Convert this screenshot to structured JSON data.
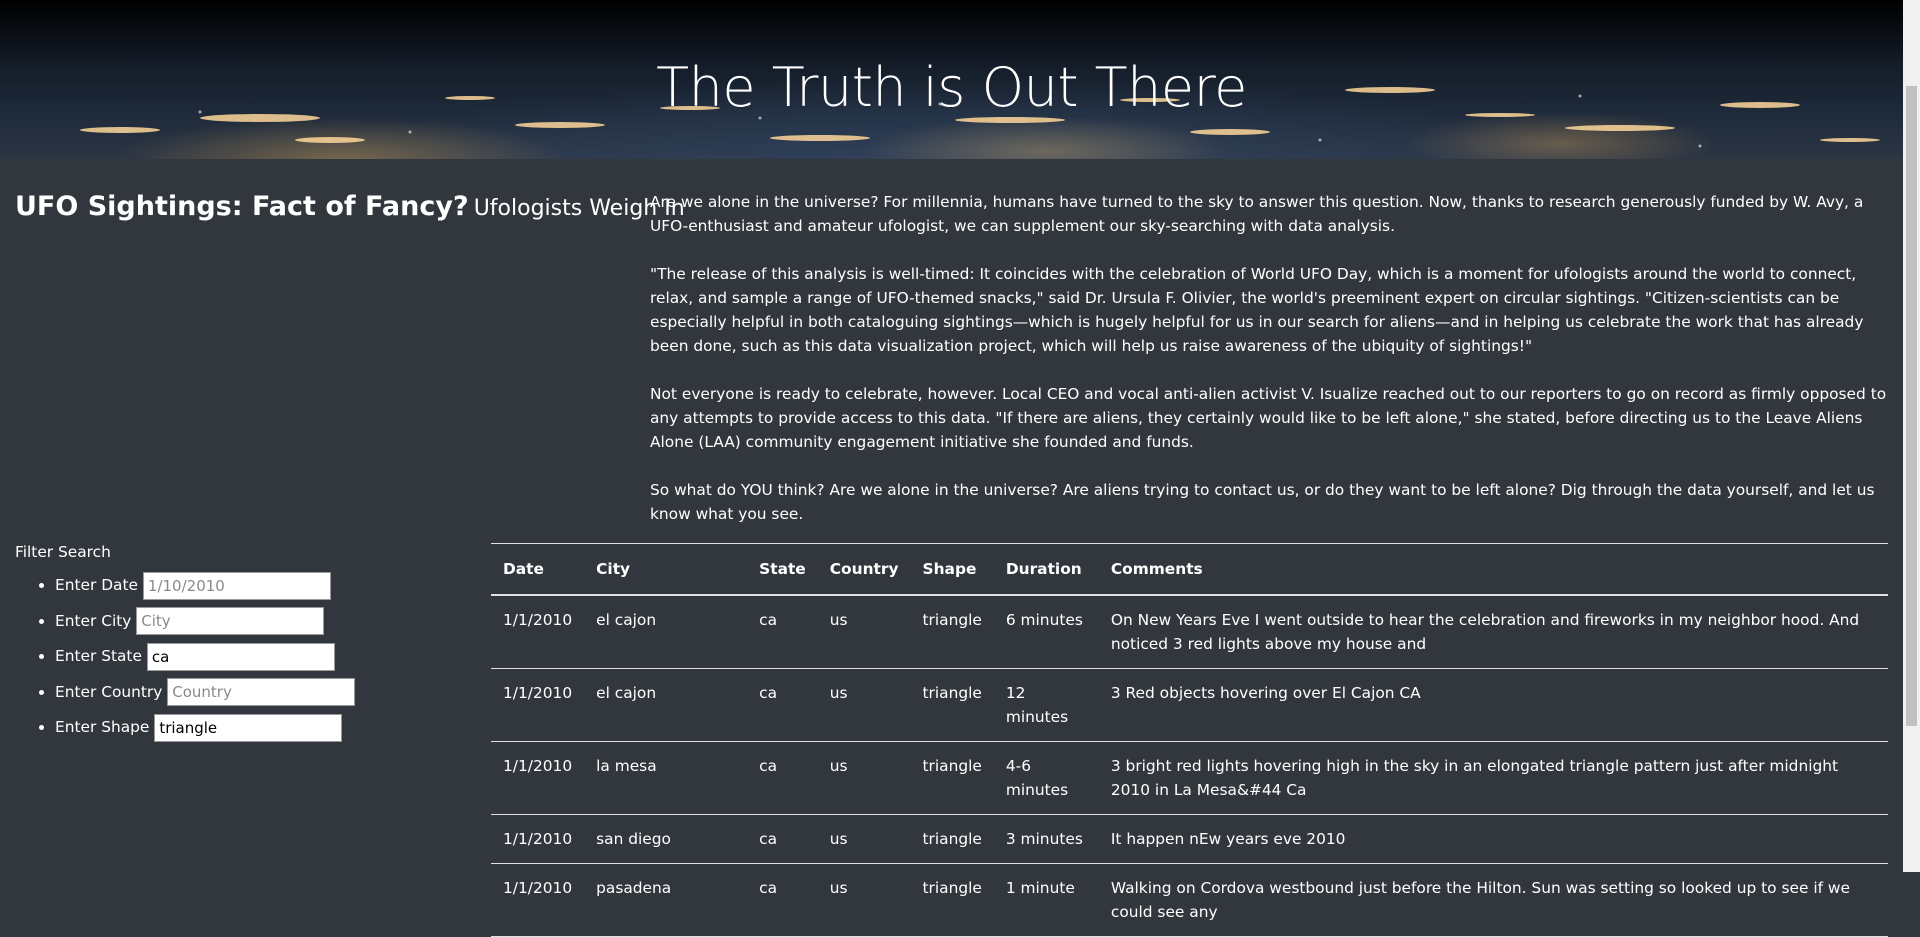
{
  "header": {
    "title": "The Truth is Out There"
  },
  "headline": {
    "main": "UFO Sightings: Fact of Fancy?",
    "sub": "Ufologists Weigh In"
  },
  "article": {
    "paragraphs": [
      "Are we alone in the universe? For millennia, humans have turned to the sky to answer this question. Now, thanks to research generously funded by W. Avy, a UFO-enthusiast and amateur ufologist, we can supplement our sky-searching with data analysis.",
      "\"The release of this analysis is well-timed: It coincides with the celebration of World UFO Day, which is a moment for ufologists around the world to connect, relax, and sample a range of UFO-themed snacks,\" said Dr. Ursula F. Olivier, the world's preeminent expert on circular sightings. \"Citizen-scientists can be especially helpful in both cataloguing sightings—which is hugely helpful for us in our search for aliens—and in helping us celebrate the work that has already been done, such as this data visualization project, which will help us raise awareness of the ubiquity of sightings!\"",
      "Not everyone is ready to celebrate, however. Local CEO and vocal anti-alien activist V. Isualize reached out to our reporters to go on record as firmly opposed to any attempts to provide access to this data. \"If there are aliens, they certainly would like to be left alone,\" she stated, before directing us to the Leave Aliens Alone (LAA) community engagement initiative she founded and funds.",
      "So what do YOU think? Are we alone in the universe? Are aliens trying to contact us, or do they want to be left alone? Dig through the data yourself, and let us know what you see."
    ]
  },
  "filter": {
    "title": "Filter Search",
    "fields": [
      {
        "label": "Enter Date",
        "value": "",
        "placeholder": "1/10/2010"
      },
      {
        "label": "Enter City",
        "value": "",
        "placeholder": "City"
      },
      {
        "label": "Enter State",
        "value": "ca",
        "placeholder": ""
      },
      {
        "label": "Enter Country",
        "value": "",
        "placeholder": "Country"
      },
      {
        "label": "Enter Shape",
        "value": "triangle",
        "placeholder": ""
      }
    ]
  },
  "table": {
    "headers": [
      "Date",
      "City",
      "State",
      "Country",
      "Shape",
      "Duration",
      "Comments"
    ],
    "rows": [
      [
        "1/1/2010",
        "el cajon",
        "ca",
        "us",
        "triangle",
        "6 minutes",
        "On New Years Eve I went outside to hear the celebration and fireworks in my neighbor hood. And noticed 3 red lights above my house and"
      ],
      [
        "1/1/2010",
        "el cajon",
        "ca",
        "us",
        "triangle",
        "12 minutes",
        "3 Red objects hovering over El Cajon CA"
      ],
      [
        "1/1/2010",
        "la mesa",
        "ca",
        "us",
        "triangle",
        "4-6 minutes",
        "3 bright red lights hovering high in the sky in an elongated triangle pattern just after midnight 2010 in La Mesa&#44 Ca"
      ],
      [
        "1/1/2010",
        "san diego",
        "ca",
        "us",
        "triangle",
        "3 minutes",
        "It happen nEw years eve 2010"
      ],
      [
        "1/1/2010",
        "pasadena",
        "ca",
        "us",
        "triangle",
        "1 minute",
        "Walking on Cordova westbound just before the Hilton. Sun was setting so looked up to see if we could see any"
      ]
    ]
  }
}
